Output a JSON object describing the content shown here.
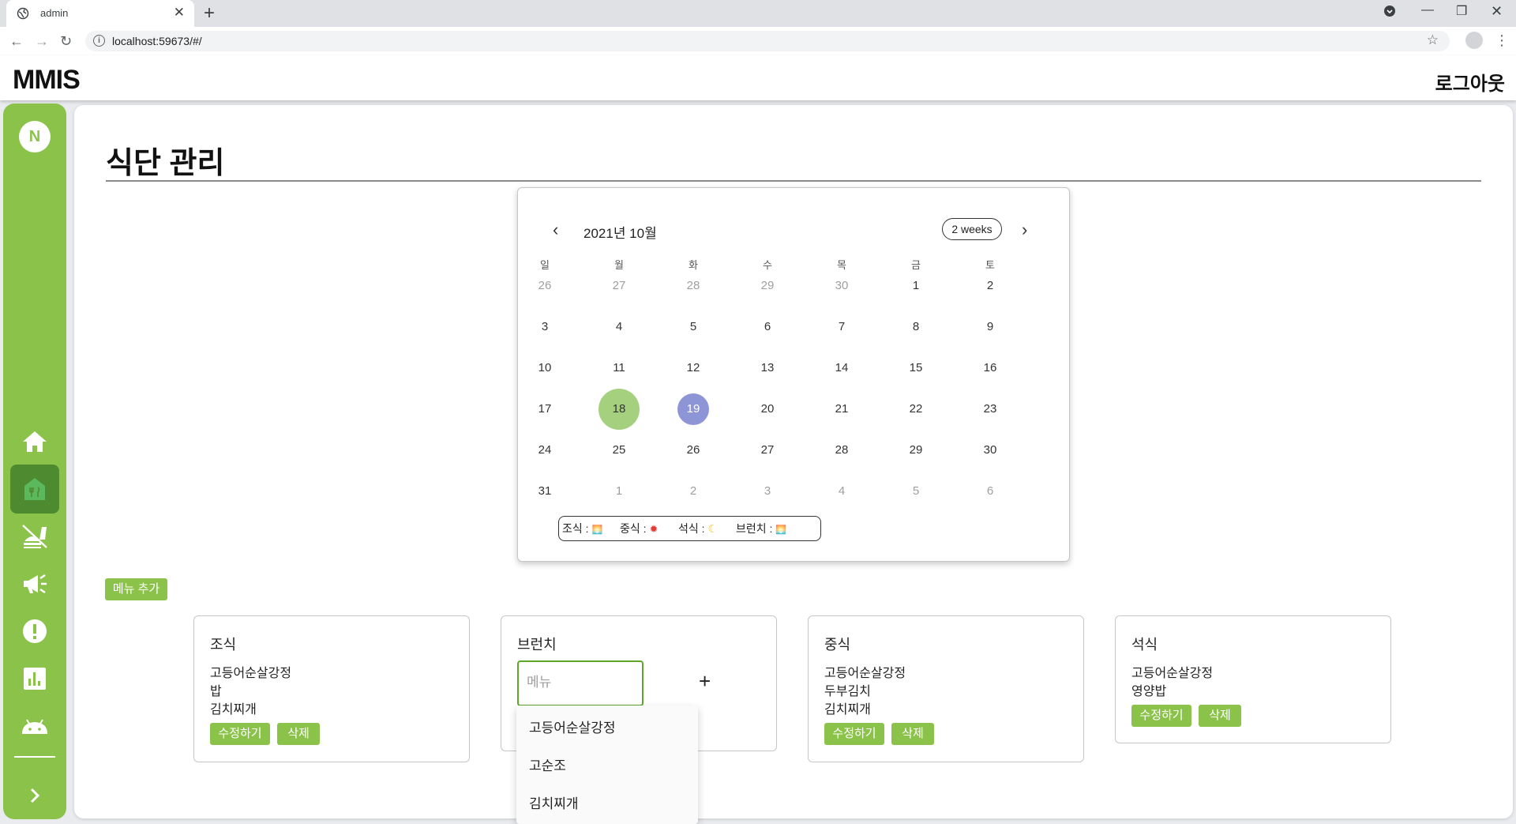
{
  "browser": {
    "tab_title": "admin",
    "url": "localhost:59673/#/"
  },
  "app": {
    "brand": "MMIS",
    "logout_label": "로그아웃"
  },
  "sidebar": {
    "avatar_letter": "N",
    "items": [
      {
        "name": "home",
        "icon": "home-icon"
      },
      {
        "name": "meal",
        "icon": "meal-house-icon",
        "active": true
      },
      {
        "name": "no-food",
        "icon": "no-food-icon"
      },
      {
        "name": "announcement",
        "icon": "megaphone-icon"
      },
      {
        "name": "alert",
        "icon": "alert-icon"
      },
      {
        "name": "statistics",
        "icon": "bar-chart-icon"
      },
      {
        "name": "android",
        "icon": "android-icon"
      }
    ],
    "expand_icon": "chevron-right-icon"
  },
  "page": {
    "title": "식단 관리"
  },
  "calendar": {
    "month_label": "2021년 10월",
    "view_toggle": "2 weeks",
    "weekdays": [
      "일",
      "월",
      "화",
      "수",
      "목",
      "금",
      "토"
    ],
    "weeks": [
      [
        "26",
        "27",
        "28",
        "29",
        "30",
        "1",
        "2"
      ],
      [
        "3",
        "4",
        "5",
        "6",
        "7",
        "8",
        "9"
      ],
      [
        "10",
        "11",
        "12",
        "13",
        "14",
        "15",
        "16"
      ],
      [
        "17",
        "18",
        "19",
        "20",
        "21",
        "22",
        "23"
      ],
      [
        "24",
        "25",
        "26",
        "27",
        "28",
        "29",
        "30"
      ],
      [
        "31",
        "1",
        "2",
        "3",
        "4",
        "5",
        "6"
      ]
    ],
    "today": "18",
    "selected": "19",
    "legend": {
      "breakfast": "조식 :",
      "lunch": "중식 :",
      "dinner": "석식 :",
      "brunch": "브런치 :"
    }
  },
  "add_menu_label": "메뉴 추가",
  "meals": {
    "breakfast": {
      "title": "조식",
      "items": [
        "고등어순살강정",
        "밥",
        "김치찌개"
      ],
      "edit_label": "수정하기",
      "delete_label": "삭제"
    },
    "brunch": {
      "title": "브런치",
      "input_value": "",
      "input_placeholder": "메뉴",
      "suggestions": [
        "고등어순살강정",
        "고순조",
        "김치찌개"
      ]
    },
    "lunch": {
      "title": "중식",
      "items": [
        "고등어순살강정",
        "두부김치",
        "김치찌개"
      ],
      "edit_label": "수정하기",
      "delete_label": "삭제"
    },
    "dinner": {
      "title": "석식",
      "items": [
        "고등어순살강정",
        "영양밥"
      ],
      "edit_label": "수정하기",
      "delete_label": "삭제"
    }
  },
  "colors": {
    "accent": "#8bc34a",
    "active": "#4e8a2f",
    "today": "#a5d07e",
    "selected": "#8e95d6"
  }
}
